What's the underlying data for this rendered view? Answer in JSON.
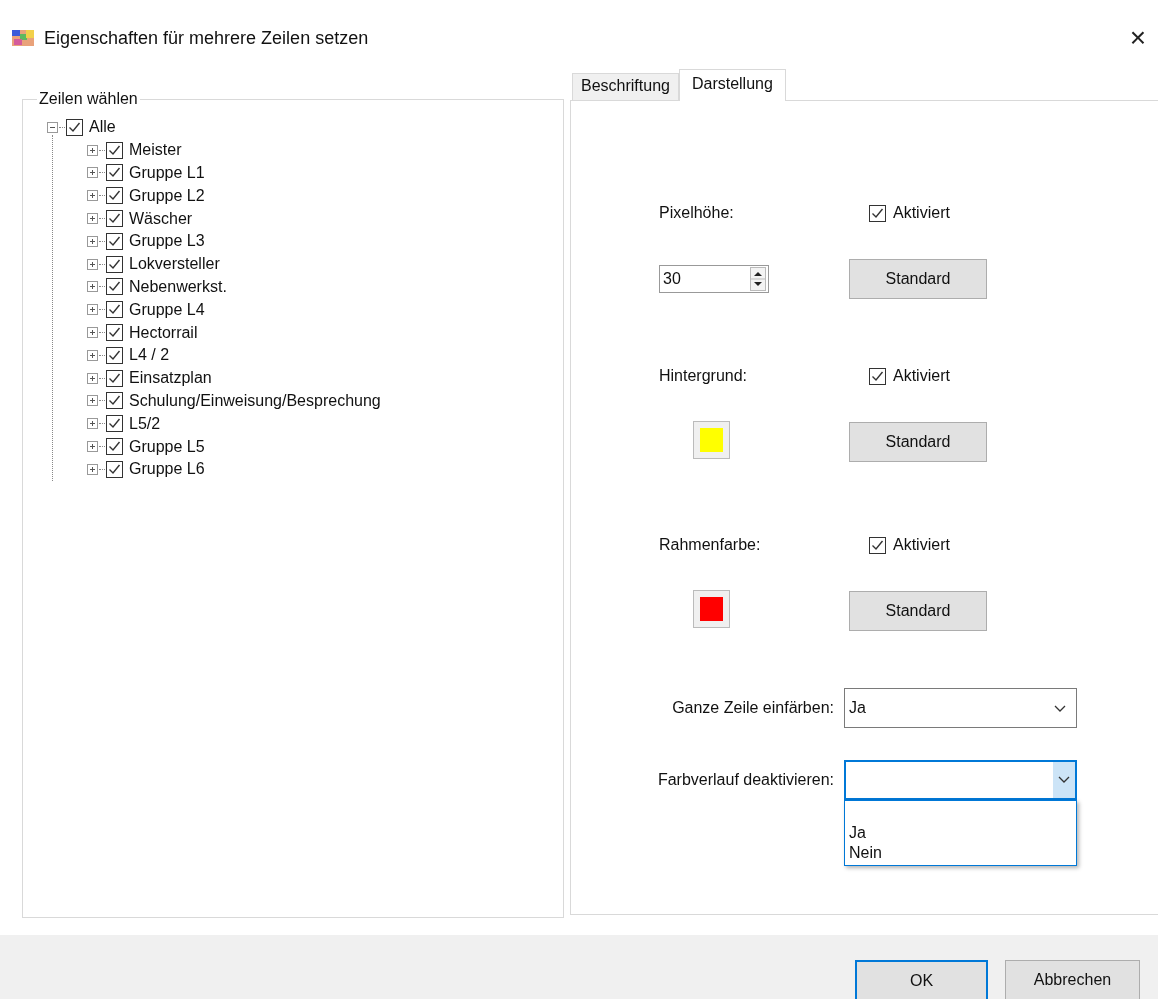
{
  "window": {
    "title": "Eigenschaften für mehrere Zeilen setzen",
    "close_glyph": "×"
  },
  "row_group": {
    "title": "Zeilen wählen",
    "tree": {
      "label": "Alle",
      "checked": true,
      "expanded": true,
      "children": [
        {
          "label": "Meister",
          "checked": true,
          "expanded": false
        },
        {
          "label": "Gruppe L1",
          "checked": true,
          "expanded": false
        },
        {
          "label": "Gruppe L2",
          "checked": true,
          "expanded": false
        },
        {
          "label": "Wäscher",
          "checked": true,
          "expanded": false
        },
        {
          "label": "Gruppe L3",
          "checked": true,
          "expanded": false
        },
        {
          "label": "Lokversteller",
          "checked": true,
          "expanded": false
        },
        {
          "label": "Nebenwerkst.",
          "checked": true,
          "expanded": false
        },
        {
          "label": "Gruppe L4",
          "checked": true,
          "expanded": false
        },
        {
          "label": "Hectorrail",
          "checked": true,
          "expanded": false
        },
        {
          "label": "L4 / 2",
          "checked": true,
          "expanded": false
        },
        {
          "label": "Einsatzplan",
          "checked": true,
          "expanded": false
        },
        {
          "label": "Schulung/Einweisung/Besprechung",
          "checked": true,
          "expanded": false
        },
        {
          "label": "L5/2",
          "checked": true,
          "expanded": false
        },
        {
          "label": "Gruppe L5",
          "checked": true,
          "expanded": false
        },
        {
          "label": "Gruppe L6",
          "checked": true,
          "expanded": false
        }
      ]
    }
  },
  "tabs": [
    {
      "label": "Beschriftung",
      "selected": false
    },
    {
      "label": "Darstellung",
      "selected": true
    }
  ],
  "settings": [
    {
      "kind": "spinner",
      "label": "Pixelhöhe:",
      "checkbox_label": "Aktiviert",
      "checked": true,
      "value": "30",
      "button": "Standard"
    },
    {
      "kind": "color",
      "label": "Hintergrund:",
      "checkbox_label": "Aktiviert",
      "checked": true,
      "color": "#ffff00",
      "button": "Standard"
    },
    {
      "kind": "color",
      "label": "Rahmenfarbe:",
      "checkbox_label": "Aktiviert",
      "checked": true,
      "color": "#ff0000",
      "button": "Standard"
    }
  ],
  "combos": [
    {
      "label": "Ganze Zeile einfärben:",
      "value": "Ja",
      "focused": false
    },
    {
      "label": "Farbverlauf deaktivieren:",
      "focused": true,
      "open": true,
      "options": [
        "Ja",
        "Nein"
      ]
    }
  ],
  "buttons": [
    {
      "label": "OK",
      "default": true
    },
    {
      "label": "Abbrechen",
      "default": false
    }
  ]
}
